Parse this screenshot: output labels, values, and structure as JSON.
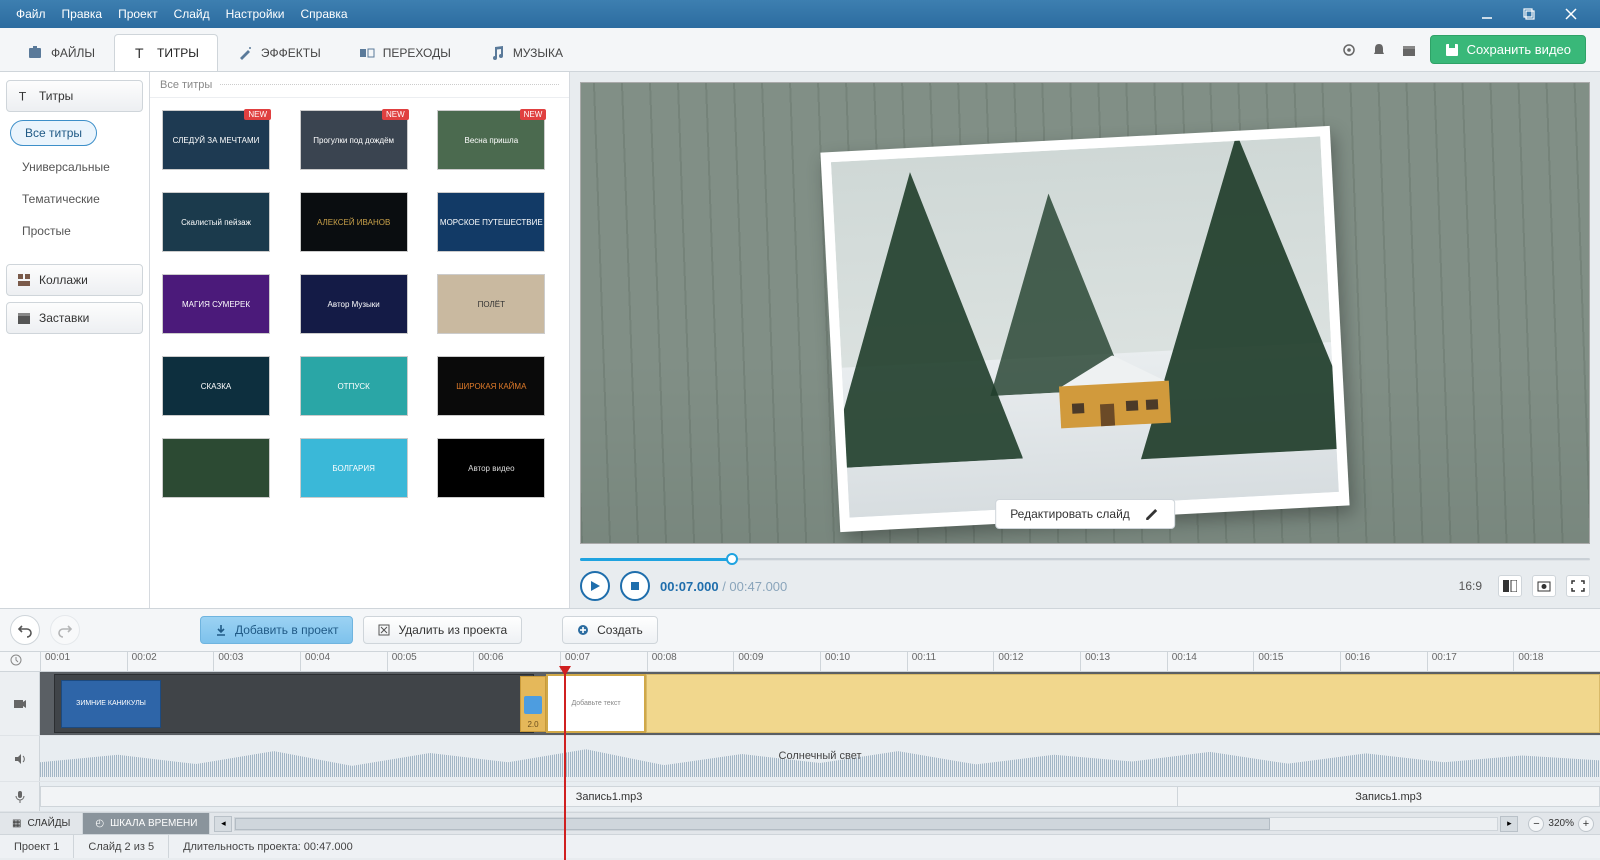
{
  "menu": {
    "items": [
      "Файл",
      "Правка",
      "Проект",
      "Слайд",
      "Настройки",
      "Справка"
    ]
  },
  "tabs": [
    {
      "label": "ФАЙЛЫ",
      "icon": "files-icon"
    },
    {
      "label": "ТИТРЫ",
      "icon": "text-icon",
      "active": true
    },
    {
      "label": "ЭФФЕКТЫ",
      "icon": "wand-icon"
    },
    {
      "label": "ПЕРЕХОДЫ",
      "icon": "transition-icon"
    },
    {
      "label": "МУЗЫКА",
      "icon": "music-icon"
    }
  ],
  "save_label": "Сохранить видео",
  "sidebar": {
    "section_main": "Титры",
    "chip": "Все титры",
    "categories": [
      "Универсальные",
      "Тематические",
      "Простые"
    ],
    "btn_collages": "Коллажи",
    "btn_intros": "Заставки"
  },
  "gallery": {
    "header": "Все титры",
    "new_badge": "NEW",
    "items": [
      {
        "t": "СЛЕДУЙ ЗА МЕЧТАМИ",
        "bg": "#1e3a52",
        "new": true
      },
      {
        "t": "Прогулки под дождём",
        "bg": "#3a4450",
        "new": true
      },
      {
        "t": "Весна пришла",
        "bg": "#4b6a4f",
        "new": true
      },
      {
        "t": "Скалистый пейзаж",
        "bg": "#1b3a4c"
      },
      {
        "t": "АЛЕКСЕЙ ИВАНОВ",
        "bg": "#0a0d10",
        "fg": "#c9a14a"
      },
      {
        "t": "МОРСКОЕ ПУТЕШЕСТВИЕ",
        "bg": "#123a66"
      },
      {
        "t": "МАГИЯ СУМЕРЕК",
        "bg": "#4b1a7a"
      },
      {
        "t": "Автор Музыки",
        "bg": "#141b46"
      },
      {
        "t": "ПОЛЁТ",
        "bg": "#c9b9a0",
        "fg": "#333"
      },
      {
        "t": "СКАЗКА",
        "bg": "#0d2f3e"
      },
      {
        "t": "ОТПУСК",
        "bg": "#2aa6a6"
      },
      {
        "t": "ШИРОКАЯ КАЙМА",
        "bg": "#0a0a0a",
        "fg": "#e07b2a"
      },
      {
        "t": "",
        "bg": "#2c4a33"
      },
      {
        "t": "БОЛГАРИЯ",
        "bg": "#3ab8d8",
        "fg": "#fff"
      },
      {
        "t": "Автор видео",
        "bg": "#000",
        "fg": "#ddd"
      }
    ]
  },
  "actions": {
    "add": "Добавить в проект",
    "remove": "Удалить из проекта",
    "create": "Создать"
  },
  "preview": {
    "edit_slide": "Редактировать слайд",
    "time_current": "00:07.000",
    "time_total": "00:47.000",
    "aspect": "16:9"
  },
  "timeline": {
    "ticks": [
      "00:01",
      "00:02",
      "00:03",
      "00:04",
      "00:05",
      "00:06",
      "00:07",
      "00:08",
      "00:09",
      "00:10",
      "00:11",
      "00:12",
      "00:13",
      "00:14",
      "00:15",
      "00:16",
      "00:17",
      "00:18"
    ],
    "clip1_label": "ЗИМНИЕ КАНИКУЛЫ",
    "clip2_label": "Добавьте текст",
    "transition_duration": "2.0",
    "music_label": "Солнечный свет",
    "mic1": "Запись1.mp3",
    "mic2": "Запись1.mp3"
  },
  "bottom_tabs": {
    "slides": "СЛАЙДЫ",
    "timeline": "ШКАЛА ВРЕМЕНИ"
  },
  "zoom": "320%",
  "status": {
    "project": "Проект 1",
    "slide": "Слайд 2 из 5",
    "duration": "Длительность проекта: 00:47.000"
  }
}
